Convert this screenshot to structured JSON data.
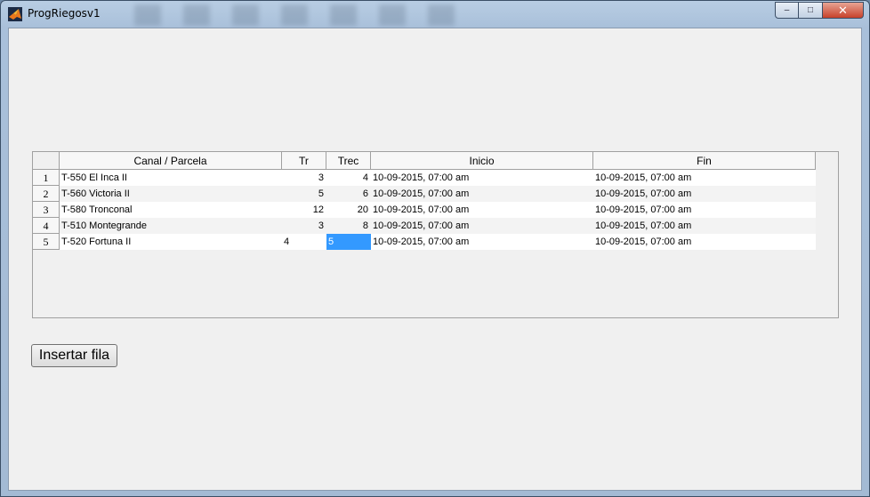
{
  "window": {
    "title": "ProgRiegosv1",
    "controls": {
      "minimize": "–",
      "maximize": "□",
      "close": "✕"
    }
  },
  "table": {
    "columns": [
      "Canal / Parcela",
      "Tr",
      "Trec",
      "Inicio",
      "Fin"
    ],
    "rows": [
      {
        "num": "1",
        "canal": "T-550 El Inca II",
        "tr": "3",
        "trec": "4",
        "inicio": "10-09-2015, 07:00 am",
        "fin": "10-09-2015, 07:00 am"
      },
      {
        "num": "2",
        "canal": "T-560 Victoria II",
        "tr": "5",
        "trec": "6",
        "inicio": "10-09-2015, 07:00 am",
        "fin": "10-09-2015, 07:00 am"
      },
      {
        "num": "3",
        "canal": "T-580 Tronconal",
        "tr": "12",
        "trec": "20",
        "inicio": "10-09-2015, 07:00 am",
        "fin": "10-09-2015, 07:00 am"
      },
      {
        "num": "4",
        "canal": "T-510 Montegrande",
        "tr": "3",
        "trec": "8",
        "inicio": "10-09-2015, 07:00 am",
        "fin": "10-09-2015, 07:00 am"
      },
      {
        "num": "5",
        "canal": "T-520 Fortuna II",
        "tr": "4",
        "trec": "5",
        "inicio": "10-09-2015, 07:00 am",
        "fin": "10-09-2015, 07:00 am"
      }
    ]
  },
  "buttons": {
    "insert_row": "Insertar fila"
  },
  "colors": {
    "selection": "#3399ff",
    "client_bg": "#f0f0f0"
  },
  "icons": {
    "app": "matlab-icon"
  }
}
